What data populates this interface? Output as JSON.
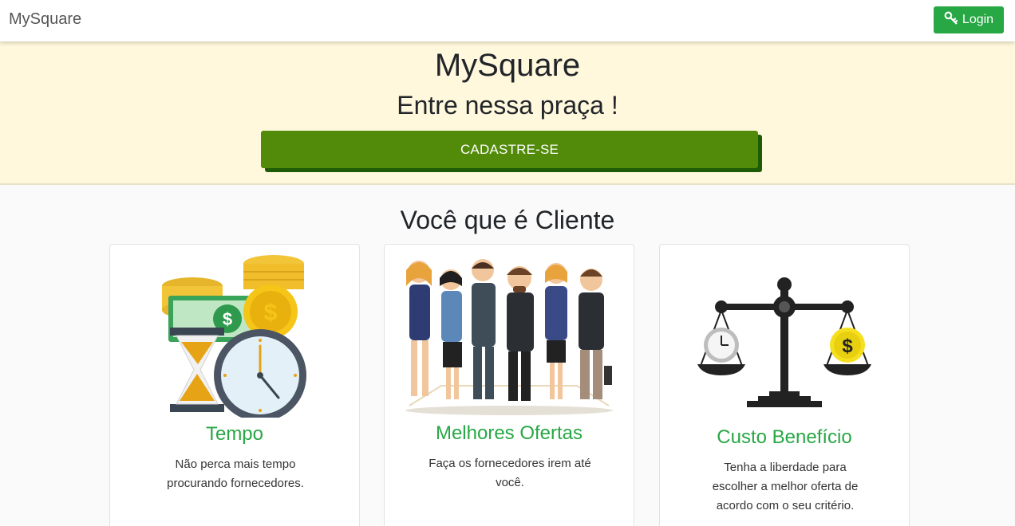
{
  "navbar": {
    "brand": "MySquare",
    "login_label": "Login"
  },
  "hero": {
    "title": "MySquare",
    "subtitle": "Entre nessa praça !",
    "cta_label": "CADASTRE-SE"
  },
  "section": {
    "title": "Você que é Cliente"
  },
  "cards": [
    {
      "title": "Tempo",
      "text": "Não perca mais tempo procurando fornecedores.",
      "image": "money-clock-hourglass-illustration"
    },
    {
      "title": "Melhores Ofertas",
      "text": "Faça os fornecedores irem até você.",
      "image": "business-people-group-illustration"
    },
    {
      "title": "Custo Benefício",
      "text": "Tenha a liberdade para escolher a melhor oferta de acordo com o seu critério.",
      "image": "balance-scale-clock-dollar-illustration"
    }
  ],
  "colors": {
    "accent": "#28a745",
    "cta": "#528a0a",
    "hero_bg": "#fff8dc"
  }
}
